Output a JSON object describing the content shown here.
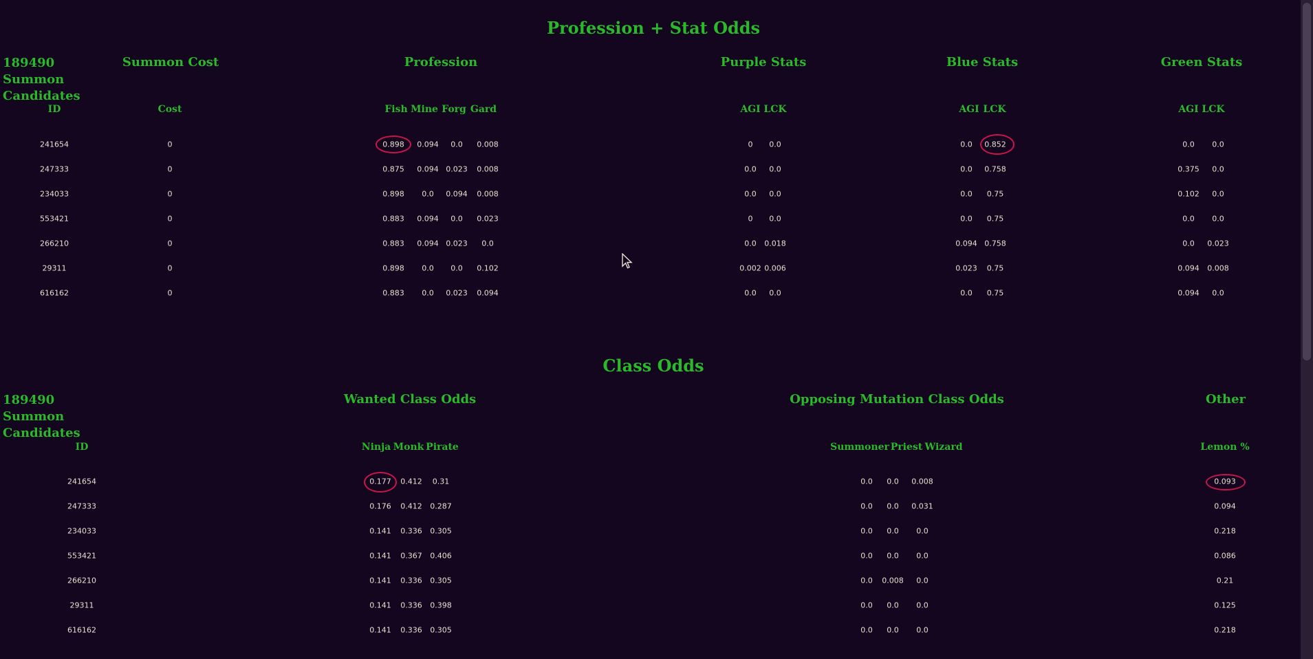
{
  "section1": {
    "title": "Profession + Stat Odds",
    "candidates_heading": "189490 Summon Candidates",
    "cost_heading": "Summon Cost",
    "profession_heading": "Profession",
    "purple_heading": "Purple Stats",
    "blue_heading": "Blue Stats",
    "green_heading": "Green Stats",
    "col_id": "ID",
    "col_cost": "Cost",
    "col_fish": "Fish",
    "col_mine": "Mine",
    "col_forg": "Forg",
    "col_gard": "Gard",
    "col_purple_agi": "AGI",
    "col_purple_lck": "LCK",
    "col_blue_agi": "AGI",
    "col_blue_lck": "LCK",
    "col_green_agi": "AGI",
    "col_green_lck": "LCK",
    "rows": [
      [
        "241654",
        "0",
        "0.898",
        "0.094",
        "0.0",
        "0.008",
        "0",
        "0.0",
        "0.0",
        "0.852",
        "0.0",
        "0.0"
      ],
      [
        "247333",
        "0",
        "0.875",
        "0.094",
        "0.023",
        "0.008",
        "0.0",
        "0.0",
        "0.0",
        "0.758",
        "0.375",
        "0.0"
      ],
      [
        "234033",
        "0",
        "0.898",
        "0.0",
        "0.094",
        "0.008",
        "0.0",
        "0.0",
        "0.0",
        "0.75",
        "0.102",
        "0.0"
      ],
      [
        "553421",
        "0",
        "0.883",
        "0.094",
        "0.0",
        "0.023",
        "0",
        "0.0",
        "0.0",
        "0.75",
        "0.0",
        "0.0"
      ],
      [
        "266210",
        "0",
        "0.883",
        "0.094",
        "0.023",
        "0.0",
        "0.0",
        "0.018",
        "0.094",
        "0.758",
        "0.0",
        "0.023"
      ],
      [
        "29311",
        "0",
        "0.898",
        "0.0",
        "0.0",
        "0.102",
        "0.002",
        "0.006",
        "0.023",
        "0.75",
        "0.094",
        "0.008"
      ],
      [
        "616162",
        "0",
        "0.883",
        "0.0",
        "0.023",
        "0.094",
        "0.0",
        "0.0",
        "0.0",
        "0.75",
        "0.094",
        "0.0"
      ]
    ]
  },
  "section2": {
    "title": "Class Odds",
    "candidates_heading": "189490 Summon Candidates",
    "wanted_heading": "Wanted Class Odds",
    "opposing_heading": "Opposing Mutation Class Odds",
    "other_heading": "Other",
    "col_id": "ID",
    "col_ninja": "Ninja",
    "col_monk": "Monk",
    "col_pirate": "Pirate",
    "col_summoner": "Summoner",
    "col_priest": "Priest",
    "col_wizard": "Wizard",
    "col_lemon": "Lemon %",
    "rows": [
      [
        "241654",
        "0.177",
        "0.412",
        "0.31",
        "0.0",
        "0.0",
        "0.008",
        "0.093"
      ],
      [
        "247333",
        "0.176",
        "0.412",
        "0.287",
        "0.0",
        "0.0",
        "0.031",
        "0.094"
      ],
      [
        "234033",
        "0.141",
        "0.336",
        "0.305",
        "0.0",
        "0.0",
        "0.0",
        "0.218"
      ],
      [
        "553421",
        "0.141",
        "0.367",
        "0.406",
        "0.0",
        "0.0",
        "0.0",
        "0.086"
      ],
      [
        "266210",
        "0.141",
        "0.336",
        "0.305",
        "0.0",
        "0.008",
        "0.0",
        "0.21"
      ],
      [
        "29311",
        "0.141",
        "0.336",
        "0.398",
        "0.0",
        "0.0",
        "0.0",
        "0.125"
      ],
      [
        "616162",
        "0.141",
        "0.336",
        "0.305",
        "0.0",
        "0.0",
        "0.0",
        "0.218"
      ]
    ]
  },
  "colors": {
    "background": "#13061e",
    "heading": "#2bb82b",
    "text": "#e8e0d0",
    "highlight": "#c8154a"
  },
  "icons": {
    "cursor": "mouse-pointer-icon"
  }
}
